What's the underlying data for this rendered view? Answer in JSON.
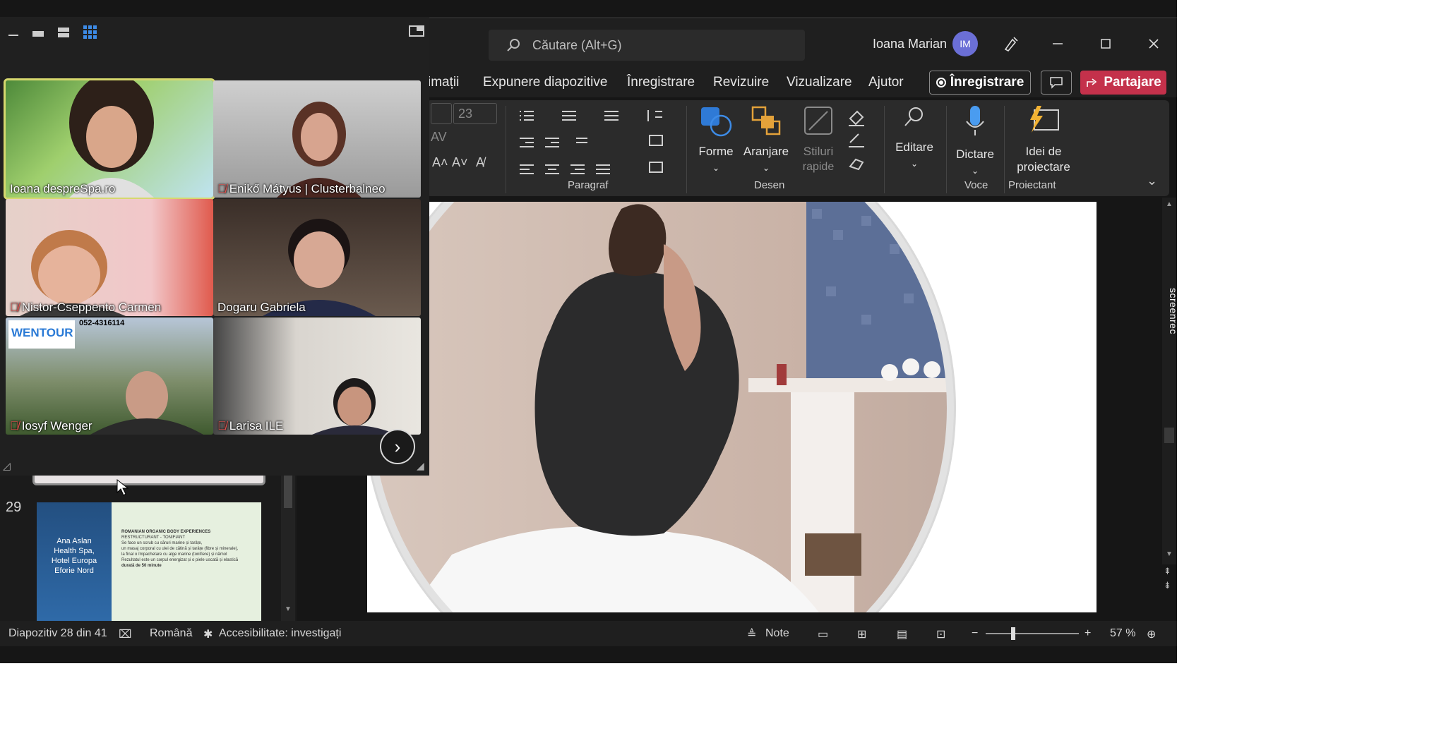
{
  "titlebar": {
    "search_placeholder": "Căutare (Alt+G)",
    "user_name": "Ioana Marian",
    "user_initials": "IM"
  },
  "menu": {
    "items": [
      "imații",
      "Expunere diapozitive",
      "Înregistrare",
      "Revizuire",
      "Vizualizare",
      "Ajutor"
    ],
    "record_label": "Înregistrare",
    "share_label": "Partajare"
  },
  "ribbon": {
    "font_size": "23",
    "groups": {
      "paragraph": "Paragraf",
      "drawing": "Desen",
      "voice": "Voce",
      "designer": "Proiectant"
    },
    "buttons": {
      "shapes": "Forme",
      "arrange": "Aranjare",
      "quick_styles_line1": "Stiluri",
      "quick_styles_line2": "rapide",
      "editing": "Editare",
      "dictate": "Dictare",
      "design_ideas_line1": "Idei de",
      "design_ideas_line2": "proiectare"
    }
  },
  "meeting": {
    "participants": [
      {
        "name": "Ioana despreSpa.ro",
        "muted": false,
        "active": true
      },
      {
        "name": "Enikő Mátyus | Clusterbalneo",
        "muted": true,
        "active": false
      },
      {
        "name": "Nistor-Cseppento Carmen",
        "muted": true,
        "active": false
      },
      {
        "name": "Dogaru Gabriela",
        "muted": false,
        "active": false
      },
      {
        "name": "Iosyf Wenger",
        "muted": true,
        "active": false
      },
      {
        "name": "Larisa ILE",
        "muted": true,
        "active": false
      }
    ],
    "logo_text": "WENTOUR",
    "phone_text": "052-4316114"
  },
  "thumbnails": {
    "slide_number": "29",
    "thumb29_title_lines": [
      "Ana Aslan",
      "Health Spa,",
      "Hotel Europa",
      "Eforie Nord"
    ],
    "thumb29_bullets": [
      "ROMANIAN ORGANIC BODY EXPERIENCES",
      "RESTRUCTURANT - TONIFIANT",
      "Se face un scrub cu săruri marine și tarâțe,",
      "un masaj corporal cu ulei de cătină și tarâțe (fibre și minerale),",
      "la final o împachetare cu alge marine (tonifiere) și nămol",
      "Rezultatul este un corpul energizat și o piele uscată și elastică",
      "durată de 50 minute"
    ]
  },
  "status": {
    "slide_info": "Diapozitiv 28 din 41",
    "language": "Română",
    "accessibility": "Accesibilitate: investigați",
    "notes": "Note",
    "zoom": "57 %"
  },
  "overlay": {
    "screenrec_text": "screenrec"
  },
  "colors": {
    "share_button": "#c4314b",
    "avatar": "#6b6fd6",
    "active_speaker": "#d6d86e",
    "mute": "#e0524f"
  }
}
